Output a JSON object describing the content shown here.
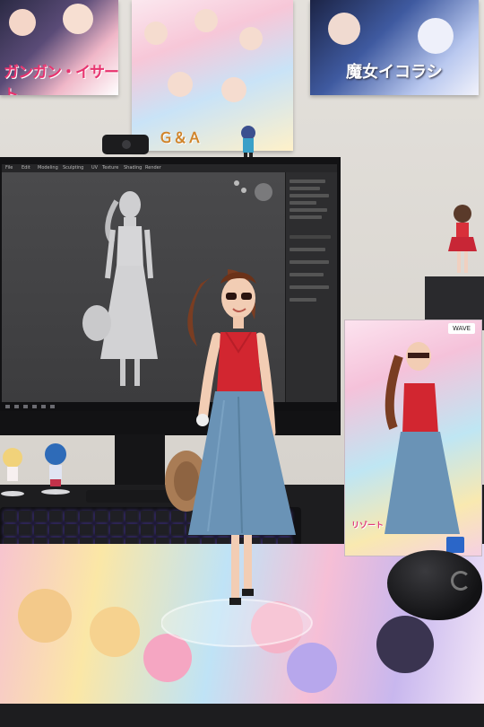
{
  "scene": {
    "posters": {
      "left_title": "ガンガン・イサート",
      "middle_title": "Ｇ＆Ａ",
      "right_title": "魔女イコラシ"
    },
    "monitor_menu": [
      "File",
      "Edit",
      "Modeling",
      "Sculpting",
      "UV",
      "Texture",
      "Shading",
      "Render"
    ],
    "box": {
      "logo": "WAVE",
      "title": "リゾート"
    },
    "colors": {
      "figure_top": "#d22630",
      "figure_skirt": "#6a93b6",
      "hair": "#7a3d22",
      "skin": "#f2cdb4",
      "sculpt": "#cfcfd1",
      "keyboard_glow": "#7a5cff"
    },
    "icons": [
      "webcam-icon",
      "mouse-icon",
      "logo-mark-icon"
    ]
  }
}
